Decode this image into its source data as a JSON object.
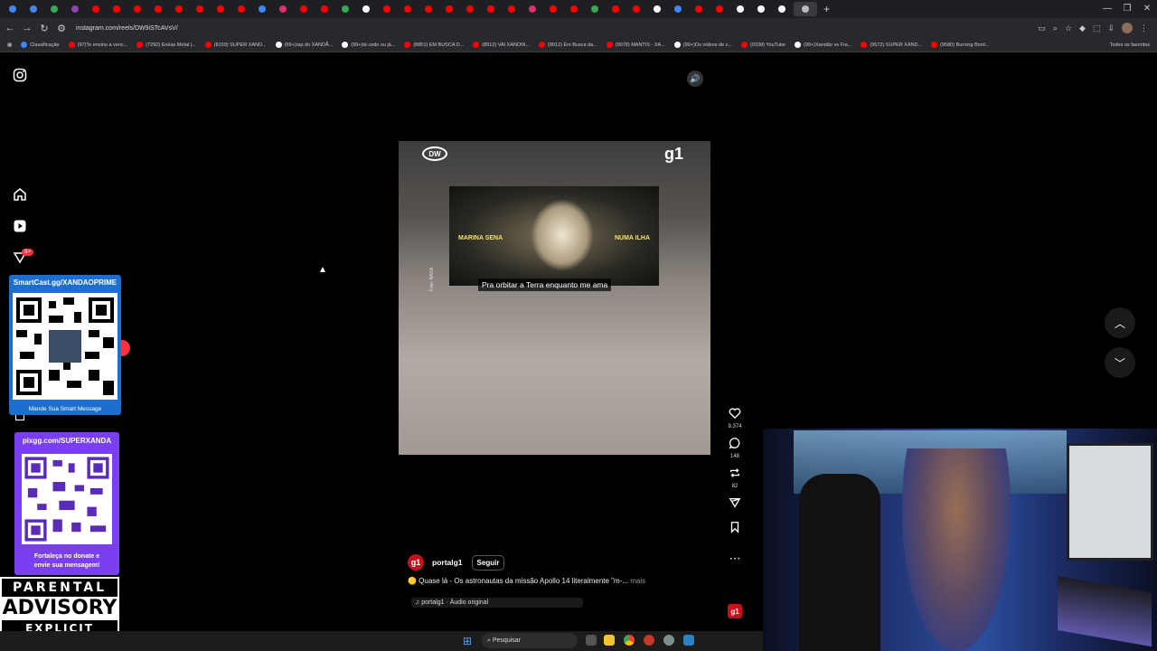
{
  "browser": {
    "url": "instagram.com/reels/DW9iSTcAVsV/",
    "new_tab": "+",
    "all_bookmarks": "Todos os favoritos",
    "bookmarks": [
      {
        "label": "Classificação",
        "color": "#4285f4"
      },
      {
        "label": "(97)Te ensino a venc...",
        "color": "#ff0000"
      },
      {
        "label": "(7292) Enéas Metal |...",
        "color": "#ff0000"
      },
      {
        "label": "(8159) SUPER XAND...",
        "color": "#ff0000"
      },
      {
        "label": "(99+)rap do XANDÃ...",
        "color": "#ffffff"
      },
      {
        "label": "(99+)tá cedo ou já...",
        "color": "#ffffff"
      },
      {
        "label": "(8851) EM BUSCA D...",
        "color": "#ff0000"
      },
      {
        "label": "(8912) VAI XANDIN...",
        "color": "#ff0000"
      },
      {
        "label": "(8912) Em Busca da...",
        "color": "#ff0000"
      },
      {
        "label": "(9078) MANTIS - XA...",
        "color": "#ff0000"
      },
      {
        "label": "(99+)Os vídeos de c...",
        "color": "#ffffff"
      },
      {
        "label": "(9338) YouTube",
        "color": "#ff0000"
      },
      {
        "label": "(99+)Xandão vs Fra...",
        "color": "#ffffff"
      },
      {
        "label": "(9572) SUPER XAND...",
        "color": "#ff0000"
      },
      {
        "label": "(9580) Burning Bord...",
        "color": "#ff0000"
      }
    ]
  },
  "sidebar": {
    "notifications_badge": "9+"
  },
  "overlay": {
    "smartcast_title": "SmartCast.gg/XANDAOPRIME",
    "smartcast_caption": "Mande Sua Smart Message",
    "pix_title": "pixgg.com/SUPERXANDA",
    "pix_caption_1": "Fortaleça no donate e",
    "pix_caption_2": "envie sua mensagem!",
    "advisory_1": "PARENTAL",
    "advisory_2": "ADVISORY",
    "advisory_3": "EXPLICIT CONTENT"
  },
  "reel": {
    "dw_logo": "DW",
    "g1_logo": "g1",
    "clip_left": "MARINA SENA",
    "clip_right": "NUMA ILHA",
    "subtitle": "Pra orbitar a Terra enquanto me ama",
    "credit": "Foto: NASA",
    "author": "portalg1",
    "author_avatar": "g1",
    "follow": "Seguir",
    "caption": "🟡 Quase lá - Os astronautas da missão Apollo 14 literalmente \"m-...",
    "more": "mais",
    "audio": "♫ portalg1 · Áudio original",
    "likes": "9.374",
    "comments": "148",
    "reposts": "82"
  },
  "taskbar": {
    "search": "Pesquisar"
  }
}
